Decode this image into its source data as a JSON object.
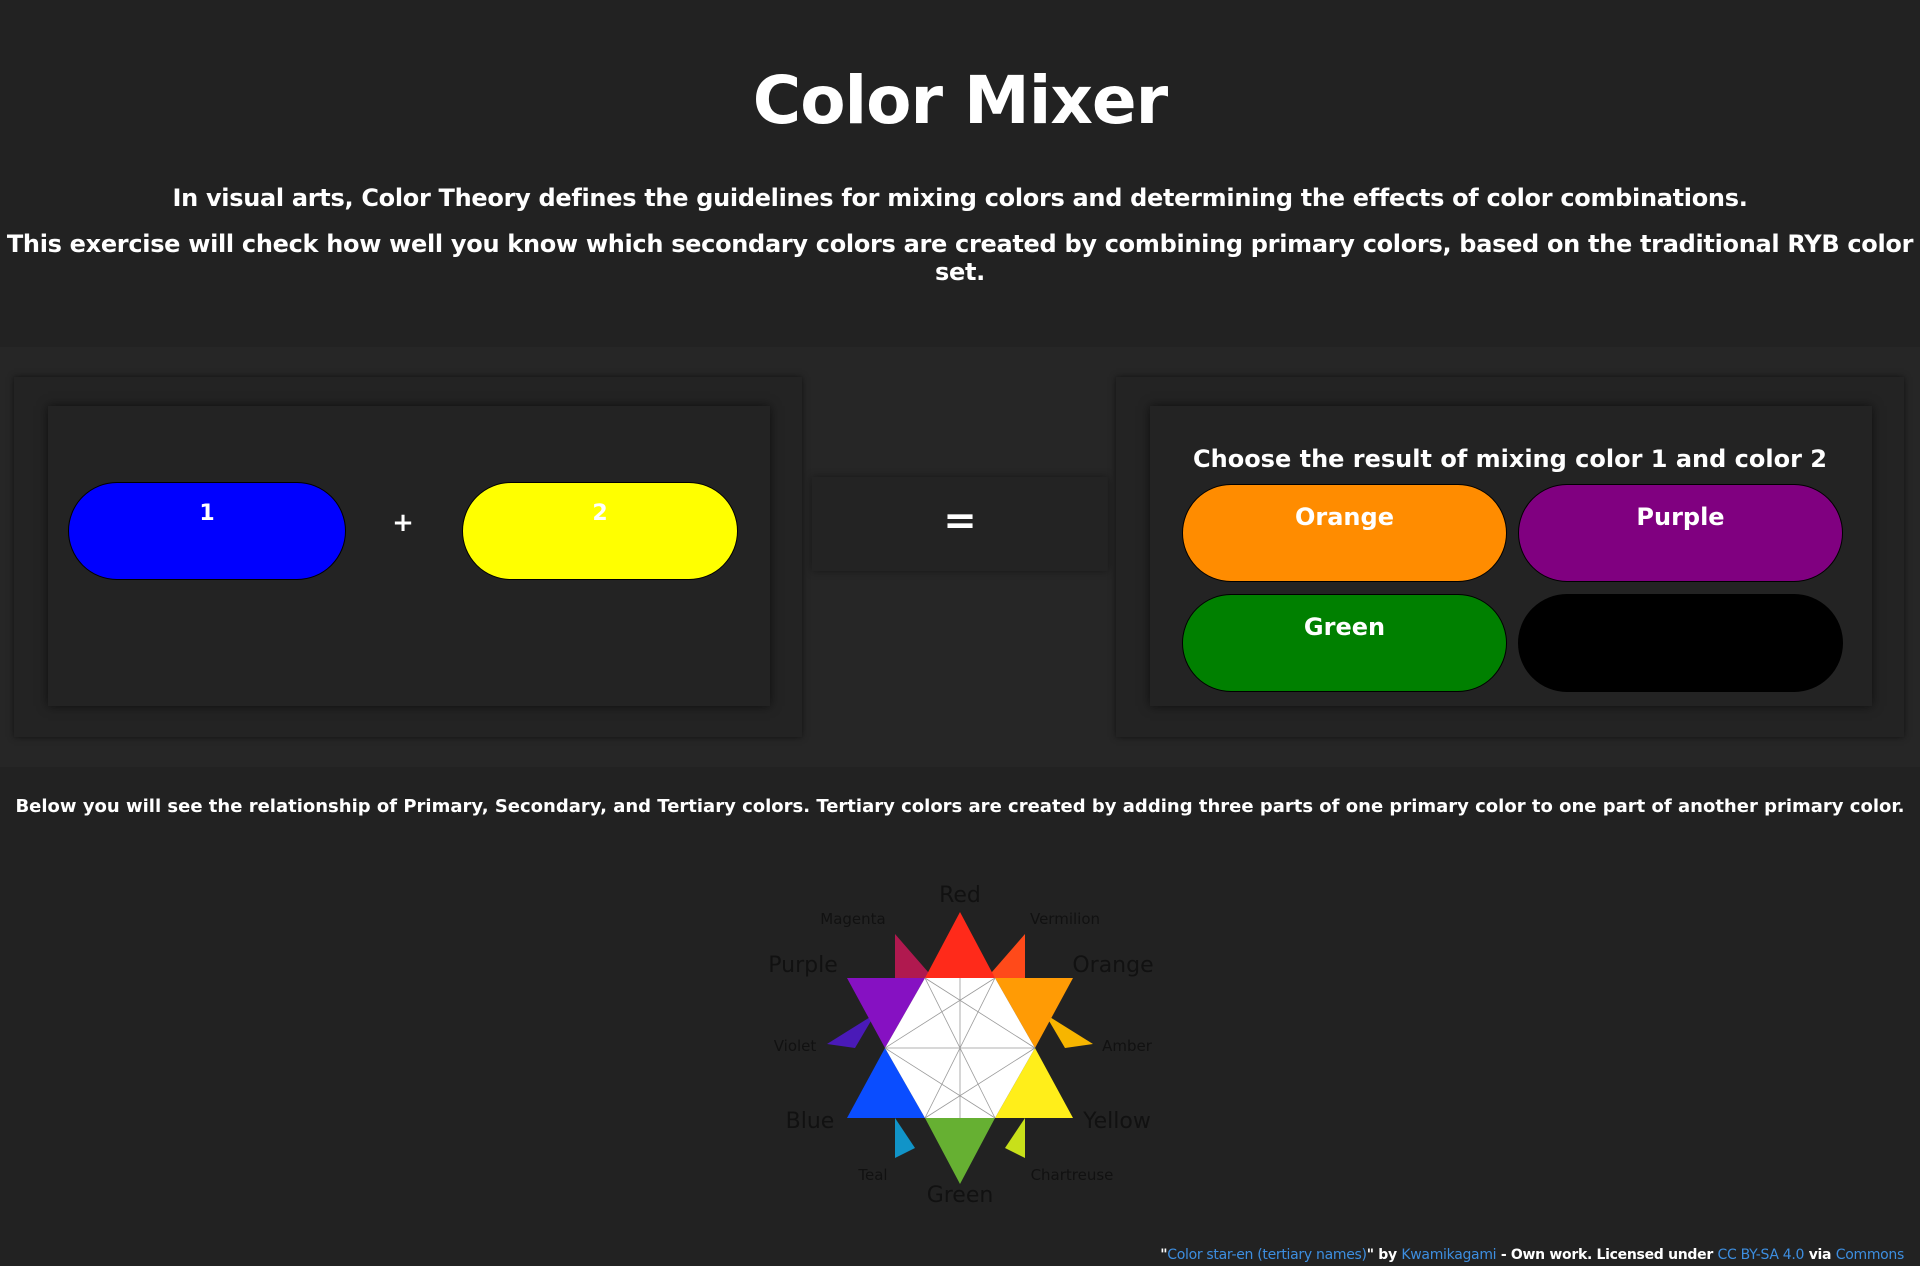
{
  "header": {
    "title": "Color Mixer",
    "intro_line1": "In visual arts, Color Theory defines the guidelines for mixing colors and determining the effects of color combinations.",
    "intro_line2": "This exercise will check how well you know which secondary colors are created by combining primary colors, based on the traditional RYB color set."
  },
  "mixer": {
    "color1": {
      "label": "1",
      "color": "#0000ff"
    },
    "plus": "+",
    "color2": {
      "label": "2",
      "color": "#ffff00"
    },
    "equals": "=",
    "choose_title": "Choose the result of mixing color 1 and color 2",
    "options": [
      {
        "label": "Orange",
        "color": "#ff8c00"
      },
      {
        "label": "Purple",
        "color": "#800080"
      },
      {
        "label": "Green",
        "color": "#008000"
      },
      {
        "label": "",
        "color": "#000000"
      }
    ]
  },
  "wheel": {
    "description": "Below you will see the relationship of Primary, Secondary, and Tertiary colors. Tertiary colors are created by adding three parts of one primary color to one part of another primary color.",
    "labels": {
      "red": "Red",
      "orange": "Orange",
      "yellow": "Yellow",
      "green": "Green",
      "blue": "Blue",
      "purple": "Purple",
      "vermilion": "Vermilion",
      "amber": "Amber",
      "chartreuse": "Chartreuse",
      "teal": "Teal",
      "violet": "Violet",
      "magenta": "Magenta"
    }
  },
  "credit": {
    "quote_open": "\"",
    "work_title": "Color star-en (tertiary names)",
    "quote_close": "\" by ",
    "author": "Kwamikagami",
    "middle": " - Own work. Licensed under ",
    "license": "CC BY-SA 4.0",
    "via": " via ",
    "source": "Commons"
  }
}
